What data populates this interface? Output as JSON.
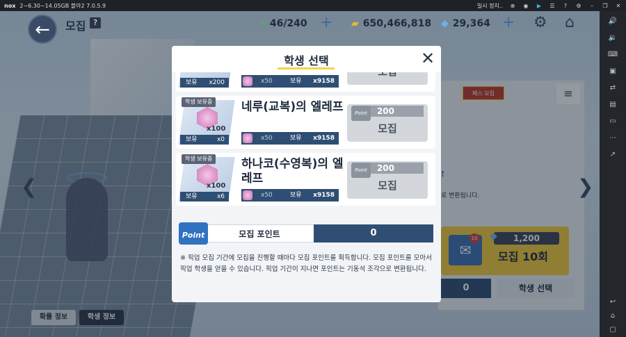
{
  "emulator": {
    "logo": "nox",
    "title": "2~6.30~14.05GB 블아2 7.0.5.9",
    "pause_label": "일시 정지.."
  },
  "header": {
    "title": "모집",
    "help": "?",
    "energy": "46/240",
    "credits": "650,466,818",
    "gems": "29,364"
  },
  "right_panel": {
    "banner": "페스 모집",
    "text1": "!",
    "text2": "로 변환됩니다.",
    "cost": "1,200",
    "gacha10": "모집 10회",
    "envelope_badge": "10",
    "points": "0",
    "select_button": "학생 선택"
  },
  "bottom_tabs": {
    "rate_info": "확률 정보",
    "student_info": "학생 정보"
  },
  "modal": {
    "title": "학생 선택",
    "cards": [
      {
        "owned_tag": "",
        "name": "",
        "count": "",
        "own_label": "보유",
        "own_count": "x200",
        "cost_mult": "x50",
        "cost_own_label": "보유",
        "cost_amount": "x9158",
        "price": "",
        "point_text": "",
        "button_label": "모집"
      },
      {
        "owned_tag": "학생 보유중",
        "name": "네루(교복)의 엘레프",
        "count": "x100",
        "own_label": "보유",
        "own_count": "x0",
        "cost_mult": "x50",
        "cost_own_label": "보유",
        "cost_amount": "x9158",
        "price": "200",
        "point_text": "Point",
        "button_label": "모집"
      },
      {
        "owned_tag": "학생 보유중",
        "name": "하나코(수영복)의 엘레프",
        "count": "x100",
        "own_label": "보유",
        "own_count": "x6",
        "cost_mult": "x50",
        "cost_own_label": "보유",
        "cost_amount": "x9158",
        "price": "200",
        "point_text": "Point",
        "button_label": "모집"
      }
    ],
    "point_badge": "Point",
    "point_label": "모집 포인트",
    "point_value": "0",
    "notice": "※ 픽업 모집 기간에 모집을 진행할 때마다 모집 포인트를 획득합니다. 모집 포인트를 모아서 픽업 학생을 얻을 수 있습니다. 픽업 기간이 지나면 포인트는 기동석 조각으로 변환됩니다."
  },
  "icons": {
    "accent": "#2f4e73",
    "highlight": "#f3d44b"
  }
}
